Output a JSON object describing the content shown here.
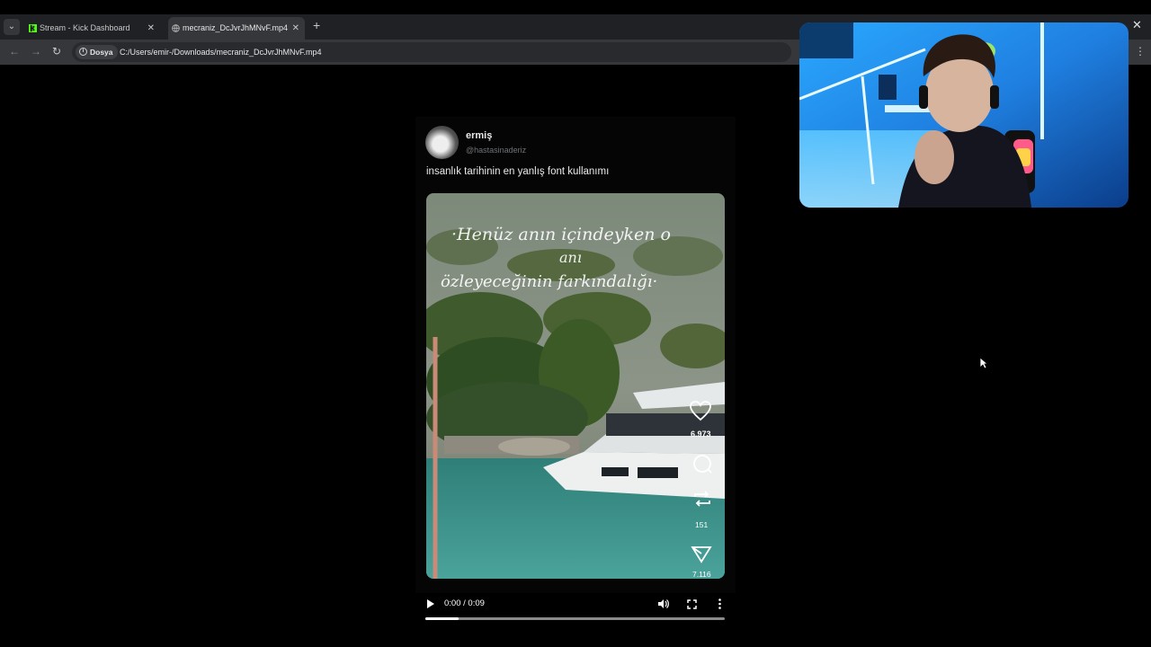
{
  "browser": {
    "tabs": [
      {
        "title": "Stream - Kick Dashboard",
        "active": false,
        "favicon": "kick-logo-icon"
      },
      {
        "title": "mecraniz_DcJvrJhMNvF.mp4",
        "active": true,
        "favicon": "globe-icon"
      }
    ],
    "security_chip": "Dosya",
    "url": "C:/Users/emir-/Downloads/mecraniz_DcJvrJhMNvF.mp4"
  },
  "post": {
    "display_name": "ermiş",
    "handle": "@hastasinaderiz",
    "caption": "insanlık tarihinin en yanlış font kullanımı",
    "overlay_text": [
      "·Henüz anın içindeyken o",
      "anı",
      "özleyeceğinin farkındalığı·"
    ],
    "likes": "6.973",
    "reposts": "151",
    "shares": "7.116"
  },
  "player": {
    "time": "0:00 / 0:09",
    "progress": 0.11
  },
  "colors": {
    "accent_kick": "#53fc18",
    "tab_bg": "#1f2124",
    "toolbar_bg": "#35373a"
  }
}
